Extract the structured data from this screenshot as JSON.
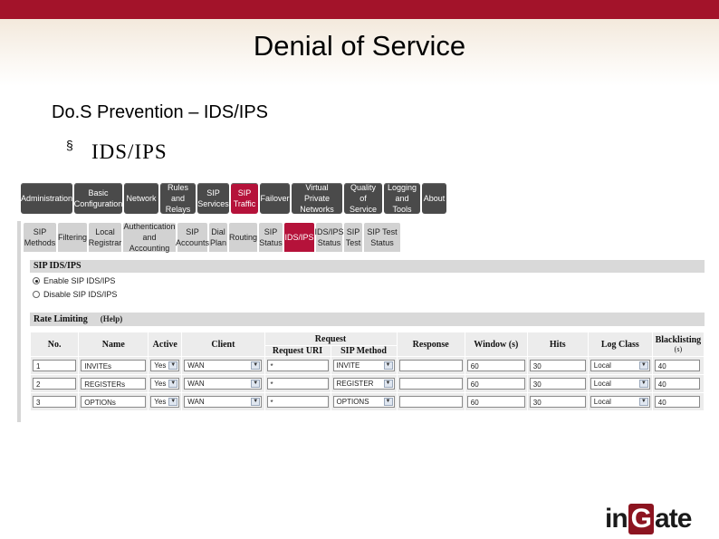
{
  "slide": {
    "title": "Denial of Service",
    "subheading": "Do.S Prevention – IDS/IPS",
    "bullet_symbol": "§",
    "bullet_text": "IDS/IPS"
  },
  "top_nav": [
    {
      "label": "Administration"
    },
    {
      "label": "Basic Configuration"
    },
    {
      "label": "Network"
    },
    {
      "label": "Rules and Relays"
    },
    {
      "label": "SIP Services"
    },
    {
      "label": "SIP Traffic"
    },
    {
      "label": "Failover"
    },
    {
      "label": "Virtual Private Networks"
    },
    {
      "label": "Quality of Service"
    },
    {
      "label": "Logging and Tools"
    },
    {
      "label": "About"
    }
  ],
  "top_nav_active": "SIP Traffic",
  "sub_nav": [
    {
      "label": "SIP Methods"
    },
    {
      "label": "Filtering"
    },
    {
      "label": "Local Registrar"
    },
    {
      "label": "Authentication and Accounting"
    },
    {
      "label": "SIP Accounts"
    },
    {
      "label": "Dial Plan"
    },
    {
      "label": "Routing"
    },
    {
      "label": "SIP Status"
    },
    {
      "label": "IDS/IPS"
    },
    {
      "label": "IDS/IPS Status"
    },
    {
      "label": "SIP Test"
    },
    {
      "label": "SIP Test Status"
    }
  ],
  "sub_nav_active": "IDS/IPS",
  "sip_ids": {
    "header": "SIP IDS/IPS",
    "options": [
      "Enable SIP IDS/IPS",
      "Disable SIP IDS/IPS"
    ],
    "selected": "Enable SIP IDS/IPS"
  },
  "rate_limiting": {
    "header": "Rate Limiting",
    "help": "(Help)",
    "columns": {
      "no": "No.",
      "name": "Name",
      "active": "Active",
      "client": "Client",
      "request": "Request",
      "request_uri": "Request URI",
      "sip_method": "SIP Method",
      "response": "Response",
      "window": "Window (s)",
      "hits": "Hits",
      "log_class": "Log Class",
      "blacklisting": "Blacklisting",
      "blacklisting_unit": "(s)"
    },
    "rows": [
      {
        "no": "1",
        "name": "INVITEs",
        "active": "Yes",
        "client": "WAN",
        "request_uri": "*",
        "sip_method": "INVITE",
        "response": "",
        "window": "60",
        "hits": "30",
        "log_class": "Local",
        "blacklisting": "40"
      },
      {
        "no": "2",
        "name": "REGISTERs",
        "active": "Yes",
        "client": "WAN",
        "request_uri": "*",
        "sip_method": "REGISTER",
        "response": "",
        "window": "60",
        "hits": "30",
        "log_class": "Local",
        "blacklisting": "40"
      },
      {
        "no": "3",
        "name": "OPTIONs",
        "active": "Yes",
        "client": "WAN",
        "request_uri": "*",
        "sip_method": "OPTIONS",
        "response": "",
        "window": "60",
        "hits": "30",
        "log_class": "Local",
        "blacklisting": "40"
      }
    ]
  },
  "logo": {
    "prefix": "in",
    "mark": "G",
    "suffix": "ate"
  },
  "colors": {
    "brand_red": "#a3132a",
    "active_tab": "#b5123a",
    "nav_dark": "#4a4a4a"
  }
}
